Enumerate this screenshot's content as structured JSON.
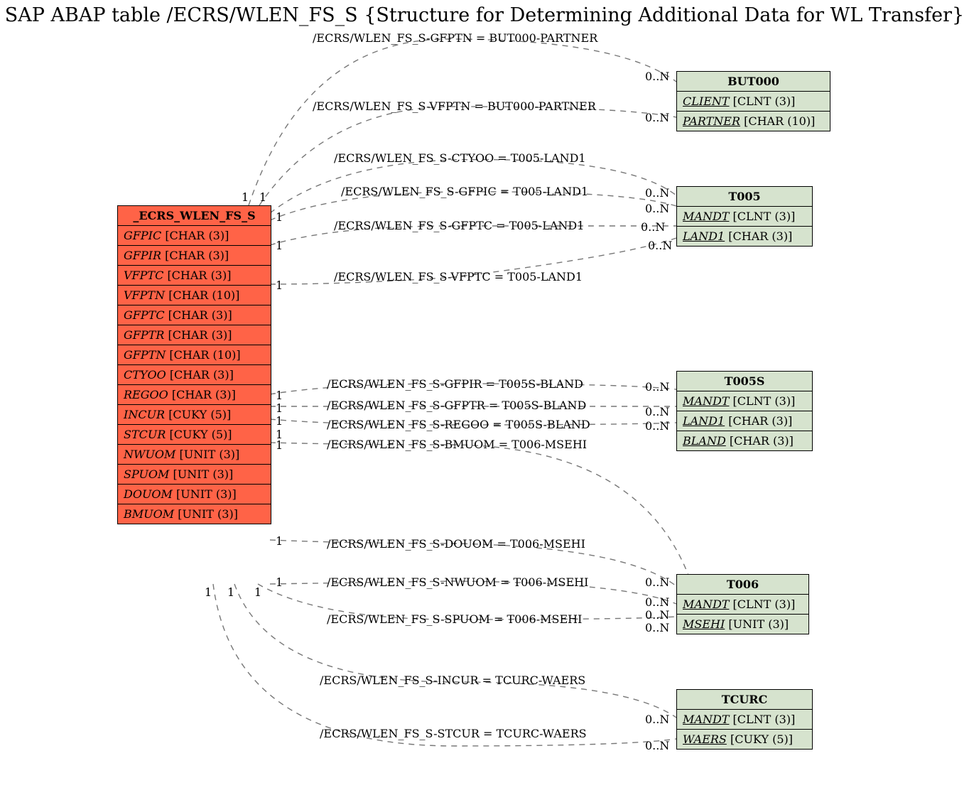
{
  "title": "SAP ABAP table /ECRS/WLEN_FS_S {Structure for Determining Additional Data for WL Transfer}",
  "main": {
    "name": "_ECRS_WLEN_FS_S",
    "fields": [
      {
        "n": "GFPIC",
        "t": "[CHAR (3)]"
      },
      {
        "n": "GFPIR",
        "t": "[CHAR (3)]"
      },
      {
        "n": "VFPTC",
        "t": "[CHAR (3)]"
      },
      {
        "n": "VFPTN",
        "t": "[CHAR (10)]"
      },
      {
        "n": "GFPTC",
        "t": "[CHAR (3)]"
      },
      {
        "n": "GFPTR",
        "t": "[CHAR (3)]"
      },
      {
        "n": "GFPTN",
        "t": "[CHAR (10)]"
      },
      {
        "n": "CTYOO",
        "t": "[CHAR (3)]"
      },
      {
        "n": "REGOO",
        "t": "[CHAR (3)]"
      },
      {
        "n": "INCUR",
        "t": "[CUKY (5)]"
      },
      {
        "n": "STCUR",
        "t": "[CUKY (5)]"
      },
      {
        "n": "NWUOM",
        "t": "[UNIT (3)]"
      },
      {
        "n": "SPUOM",
        "t": "[UNIT (3)]"
      },
      {
        "n": "DOUOM",
        "t": "[UNIT (3)]"
      },
      {
        "n": "BMUOM",
        "t": "[UNIT (3)]"
      }
    ]
  },
  "but000": {
    "name": "BUT000",
    "fields": [
      {
        "n": "CLIENT",
        "t": "[CLNT (3)]",
        "u": true,
        "i": true
      },
      {
        "n": "PARTNER",
        "t": "[CHAR (10)]",
        "u": true,
        "i": false
      }
    ]
  },
  "t005": {
    "name": "T005",
    "fields": [
      {
        "n": "MANDT",
        "t": "[CLNT (3)]",
        "u": true,
        "i": true
      },
      {
        "n": "LAND1",
        "t": "[CHAR (3)]",
        "u": true,
        "i": false
      }
    ]
  },
  "t005s": {
    "name": "T005S",
    "fields": [
      {
        "n": "MANDT",
        "t": "[CLNT (3)]",
        "u": true,
        "i": true
      },
      {
        "n": "LAND1",
        "t": "[CHAR (3)]",
        "u": true,
        "i": true
      },
      {
        "n": "BLAND",
        "t": "[CHAR (3)]",
        "u": true,
        "i": false
      }
    ]
  },
  "t006": {
    "name": "T006",
    "fields": [
      {
        "n": "MANDT",
        "t": "[CLNT (3)]",
        "u": true,
        "i": true
      },
      {
        "n": "MSEHI",
        "t": "[UNIT (3)]",
        "u": true,
        "i": false
      }
    ]
  },
  "tcurc": {
    "name": "TCURC",
    "fields": [
      {
        "n": "MANDT",
        "t": "[CLNT (3)]",
        "u": true,
        "i": false
      },
      {
        "n": "WAERS",
        "t": "[CUKY (5)]",
        "u": true,
        "i": false
      }
    ]
  },
  "labels": {
    "e1": "/ECRS/WLEN_FS_S-GFPTN = BUT000-PARTNER",
    "e2": "/ECRS/WLEN_FS_S-VFPTN = BUT000-PARTNER",
    "e3": "/ECRS/WLEN_FS_S-CTYOO = T005-LAND1",
    "e4": "/ECRS/WLEN_FS_S-GFPIC = T005-LAND1",
    "e5": "/ECRS/WLEN_FS_S-GFPTC = T005-LAND1",
    "e6": "/ECRS/WLEN_FS_S-VFPTC = T005-LAND1",
    "e7": "/ECRS/WLEN_FS_S-GFPIR = T005S-BLAND",
    "e8": "/ECRS/WLEN_FS_S-GFPTR = T005S-BLAND",
    "e9": "/ECRS/WLEN_FS_S-REGOO = T005S-BLAND",
    "e10": "/ECRS/WLEN_FS_S-BMUOM = T006-MSEHI",
    "e11": "/ECRS/WLEN_FS_S-DOUOM = T006-MSEHI",
    "e12": "/ECRS/WLEN_FS_S-NWUOM = T006-MSEHI",
    "e13": "/ECRS/WLEN_FS_S-SPUOM = T006-MSEHI",
    "e14": "/ECRS/WLEN_FS_S-INCUR = TCURC-WAERS",
    "e15": "/ECRS/WLEN_FS_S-STCUR = TCURC-WAERS"
  },
  "card": {
    "one": "1",
    "many": "0..N"
  }
}
